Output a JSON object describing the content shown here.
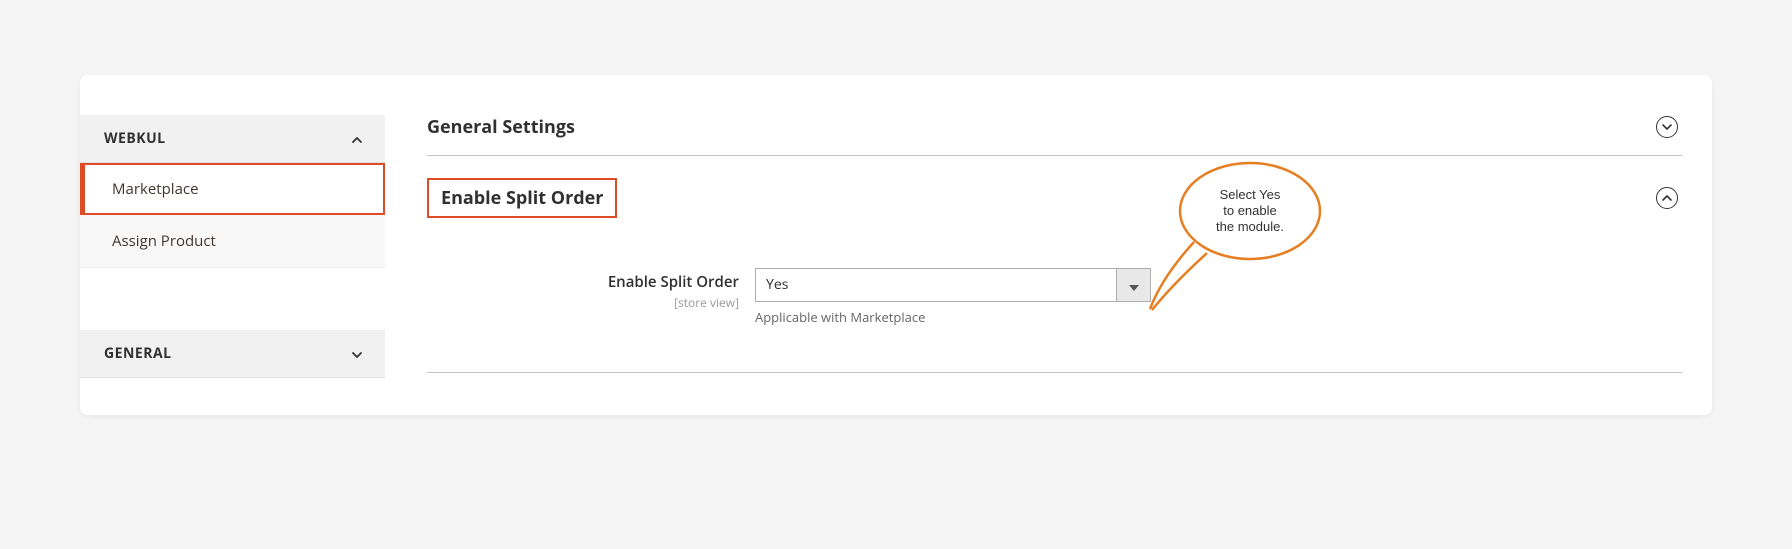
{
  "sidebar": {
    "groups": [
      {
        "label": "WEBKUL",
        "expanded": true,
        "items": [
          {
            "label": "Marketplace",
            "active": true
          },
          {
            "label": "Assign Product",
            "active": false
          }
        ]
      },
      {
        "label": "GENERAL",
        "expanded": false,
        "items": []
      }
    ]
  },
  "sections": {
    "general_settings": {
      "title": "General Settings"
    },
    "enable_split_order": {
      "title": "Enable Split Order"
    }
  },
  "field": {
    "label": "Enable Split Order",
    "scope": "[store view]",
    "value": "Yes",
    "note": "Applicable with Marketplace"
  },
  "callout": {
    "text": "Select Yes to enable the module."
  }
}
